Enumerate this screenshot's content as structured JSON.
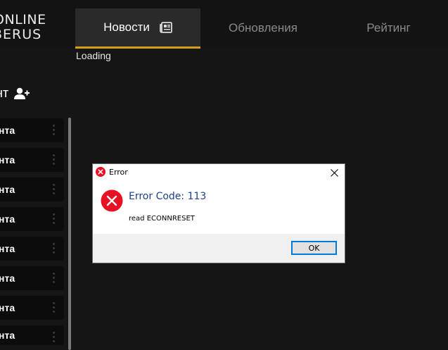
{
  "app": {
    "logo_line1": "ONLINE",
    "logo_line2": "BERUS"
  },
  "tabs": [
    {
      "label": "Новости",
      "icon": "newspaper-icon",
      "active": true
    },
    {
      "label": "Обновления",
      "active": false
    },
    {
      "label": "Рейтинг",
      "active": false
    }
  ],
  "status": {
    "loading_text": "Loading"
  },
  "accounts": {
    "title": "нт",
    "add_icon": "add-user-icon",
    "items": [
      "нта",
      "нта",
      "нта",
      "нта",
      "нта",
      "нта",
      "нта",
      "нта"
    ]
  },
  "dialog": {
    "title": "Error",
    "error_code": "Error Code: 113",
    "message": "read ECONNRESET",
    "ok_label": "OK",
    "icon": "error-icon",
    "icon_color": "#e81123"
  },
  "colors": {
    "accent": "#d7a012",
    "background": "#151515",
    "tab_active_bg": "#2a2a2a",
    "error_code_text": "#1f3f8a"
  }
}
